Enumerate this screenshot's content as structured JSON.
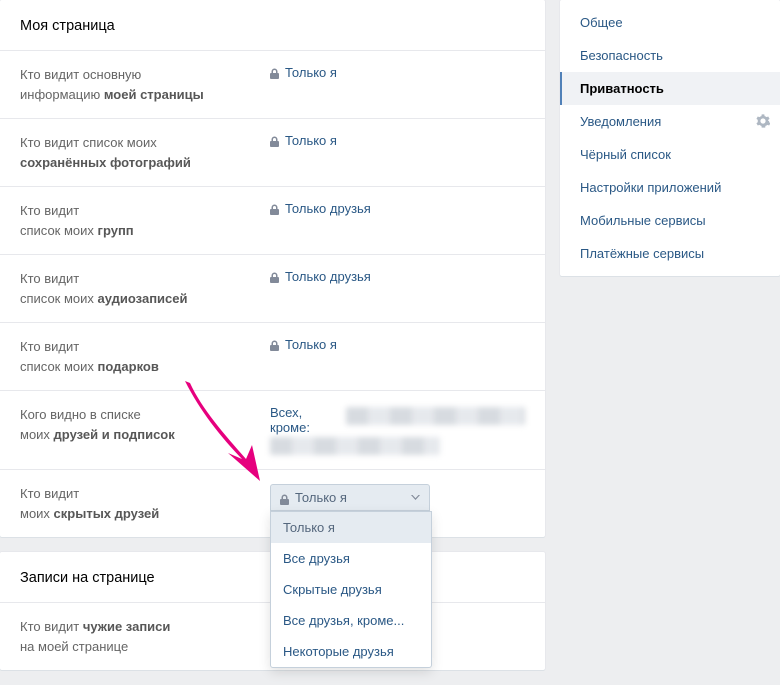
{
  "section1": {
    "title": "Моя страница",
    "rows": [
      {
        "label_pre": "Кто видит основную\nинформацию ",
        "label_bold": "моей страницы",
        "value": "Только я",
        "lock": true
      },
      {
        "label_pre": "Кто видит список моих\n",
        "label_bold": "сохранённых фотографий",
        "value": "Только я",
        "lock": true
      },
      {
        "label_pre": "Кто видит\nсписок моих ",
        "label_bold": "групп",
        "value": "Только друзья",
        "lock": true
      },
      {
        "label_pre": "Кто видит\nсписок моих ",
        "label_bold": "аудиозаписей",
        "value": "Только друзья",
        "lock": true
      },
      {
        "label_pre": "Кто видит\nсписок моих ",
        "label_bold": "подарков",
        "value": "Только я",
        "lock": true
      },
      {
        "label_pre": "Кого видно в списке\nмоих ",
        "label_bold": "друзей и подписок",
        "value_prefix": "Всех, кроме: ",
        "blurred": true
      },
      {
        "label_pre": "Кто видит\nмоих ",
        "label_bold": "скрытых друзей",
        "select_value": "Только я"
      }
    ]
  },
  "dropdown_options": [
    "Только я",
    "Все друзья",
    "Скрытые друзья",
    "Все друзья, кроме...",
    "Некоторые друзья"
  ],
  "section2": {
    "title": "Записи на странице",
    "rows": [
      {
        "label_pre": "Кто видит ",
        "label_bold": "чужие записи",
        "label_post": "\nна моей странице"
      }
    ]
  },
  "sidebar": {
    "items": [
      {
        "label": "Общее"
      },
      {
        "label": "Безопасность"
      },
      {
        "label": "Приватность",
        "active": true
      },
      {
        "label": "Уведомления",
        "gear": true
      },
      {
        "label": "Чёрный список"
      },
      {
        "label": "Настройки приложений"
      },
      {
        "label": "Мобильные сервисы"
      },
      {
        "label": "Платёжные сервисы"
      }
    ]
  }
}
